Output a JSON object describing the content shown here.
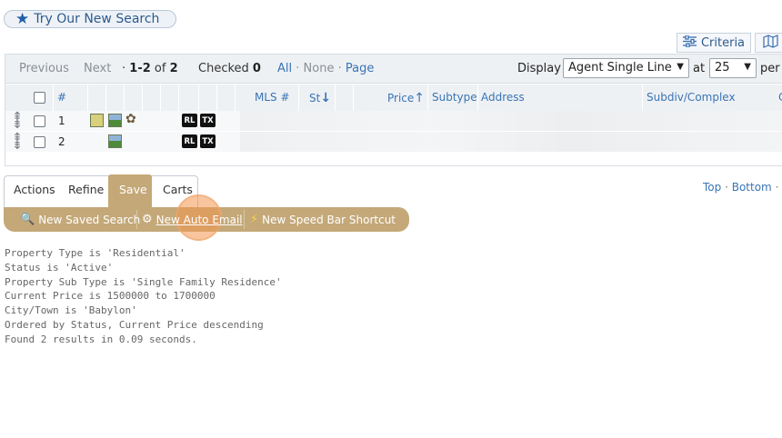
{
  "try_search": {
    "label": "Try Our New Search",
    "icon": "star-icon"
  },
  "toolbar": {
    "criteria_label": "Criteria",
    "criteria_icon": "sliders-icon",
    "map_icon": "map-icon"
  },
  "pager": {
    "previous": "Previous",
    "next": "Next",
    "range_prefix": "·",
    "range": "1-2",
    "of_label": "of",
    "total": "2",
    "checked_label": "Checked",
    "checked_count": "0",
    "select_all": "All",
    "select_none": "None",
    "select_page": "Page",
    "dot": "·",
    "display_label": "Display",
    "display_value": "Agent Single Line",
    "at_label": "at",
    "per_page_value": "25",
    "per_label": "per"
  },
  "columns": {
    "num": "#",
    "mls": "MLS #",
    "status": "St",
    "price": "Price",
    "subtype": "Subtype",
    "address": "Address",
    "subdiv": "Subdiv/Complex",
    "cut": "C"
  },
  "rows": [
    {
      "index": "1",
      "badges": [
        "RL",
        "TX"
      ]
    },
    {
      "index": "2",
      "badges": [
        "RL",
        "TX"
      ]
    }
  ],
  "tabs": {
    "actions": "Actions",
    "refine": "Refine",
    "save": "Save",
    "carts": "Carts"
  },
  "save_bar": {
    "new_saved_search": "New Saved Search",
    "new_auto_email": "New Auto Email",
    "new_speed_bar": "New Speed Bar Shortcut"
  },
  "nav": {
    "top": "Top",
    "bottom": "Bottom",
    "dot": "·"
  },
  "criteria": [
    "Property Type is 'Residential'",
    "Status is 'Active'",
    "Property Sub Type is 'Single Family Residence'",
    "Current Price is 1500000 to 1700000",
    "City/Town is 'Babylon'",
    "Ordered by Status, Current Price descending",
    "Found 2 results in 0.09 seconds."
  ],
  "colors": {
    "save_tan": "#c4a878",
    "link_blue": "#3a74b5",
    "click_highlight": "#f29650"
  }
}
